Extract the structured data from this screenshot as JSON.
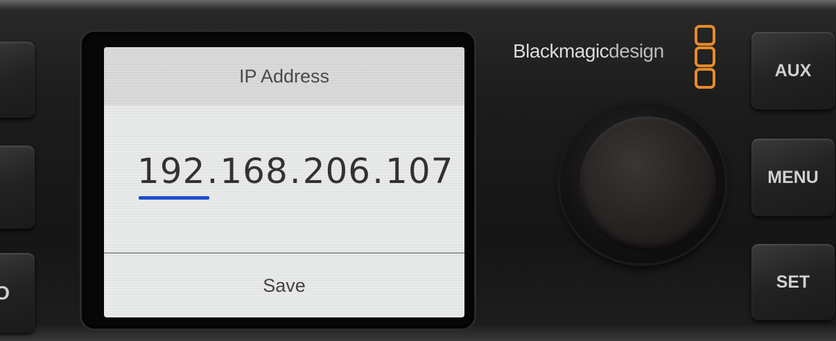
{
  "screen": {
    "title": "IP Address",
    "ip_octets": [
      "192",
      "168",
      "206",
      "107"
    ],
    "ip_separator": ".",
    "selected_octet_index": 0,
    "action_label": "Save"
  },
  "brand": {
    "name_part1": "Blackmagic",
    "name_part2": "design",
    "logo_icon": "three-stacked-squares-logo",
    "accent_color": "#e88a2a"
  },
  "buttons": {
    "aux": "AUX",
    "menu": "MENU",
    "set": "SET",
    "left_partial_3": "O"
  },
  "colors": {
    "selection_underline": "#1e4fcc"
  }
}
